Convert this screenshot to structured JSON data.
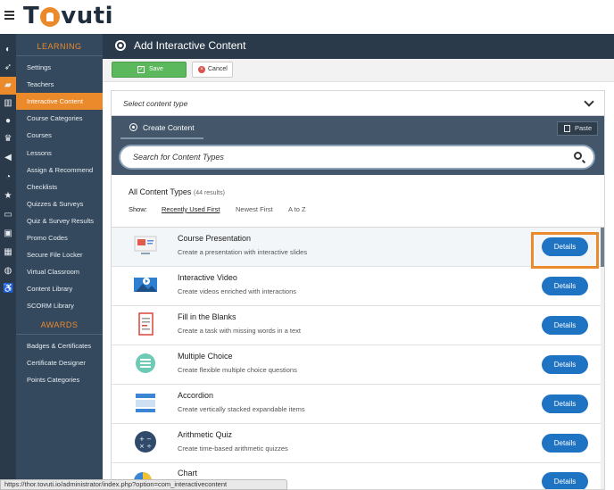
{
  "app": {
    "logo_text": "Tovuti"
  },
  "sidebar": {
    "sections": [
      {
        "heading": "LEARNING",
        "items": [
          {
            "label": "Settings"
          },
          {
            "label": "Teachers"
          },
          {
            "label": "Interactive Content",
            "active": true
          },
          {
            "label": "Course Categories"
          },
          {
            "label": "Courses"
          },
          {
            "label": "Lessons"
          },
          {
            "label": "Assign & Recommend"
          },
          {
            "label": "Checklists"
          },
          {
            "label": "Quizzes & Surveys"
          },
          {
            "label": "Quiz & Survey Results"
          },
          {
            "label": "Promo Codes"
          },
          {
            "label": "Secure File Locker"
          },
          {
            "label": "Virtual Classroom"
          },
          {
            "label": "Content Library"
          },
          {
            "label": "SCORM Library"
          }
        ]
      },
      {
        "heading": "AWARDS",
        "items": [
          {
            "label": "Badges & Certificates"
          },
          {
            "label": "Certificate Designer"
          },
          {
            "label": "Points Categories"
          }
        ]
      }
    ],
    "rail_icons": [
      "dashboard-icon",
      "rocket-icon",
      "graduation-cap-icon",
      "bar-chart-icon",
      "users-icon",
      "trophy-icon",
      "megaphone-icon",
      "rss-icon",
      "star-icon",
      "credit-card-icon",
      "contact-card-icon",
      "calendar-icon",
      "chat-icon",
      "accessibility-icon"
    ]
  },
  "header": {
    "title": "Add Interactive Content"
  },
  "toolbar": {
    "save_label": "Save",
    "cancel_label": "Cancel"
  },
  "h5p": {
    "select_label": "Select content type",
    "create_tab": "Create Content",
    "paste_label": "Paste",
    "search_placeholder": "Search for Content Types",
    "list_title": "All Content Types",
    "list_count": "(44 results)",
    "show_label": "Show:",
    "sort_options": [
      {
        "label": "Recently Used First",
        "active": true
      },
      {
        "label": "Newest First"
      },
      {
        "label": "A to Z"
      }
    ],
    "details_label": "Details",
    "content_types": [
      {
        "name": "Course Presentation",
        "desc": "Create a presentation with interactive slides",
        "icon": "presentation-icon",
        "highlighted": true
      },
      {
        "name": "Interactive Video",
        "desc": "Create videos enriched with interactions",
        "icon": "video-icon"
      },
      {
        "name": "Fill in the Blanks",
        "desc": "Create a task with missing words in a text",
        "icon": "document-icon"
      },
      {
        "name": "Multiple Choice",
        "desc": "Create flexible multiple choice questions",
        "icon": "multiple-choice-icon"
      },
      {
        "name": "Accordion",
        "desc": "Create vertically stacked expandable items",
        "icon": "accordion-icon"
      },
      {
        "name": "Arithmetic Quiz",
        "desc": "Create time-based arithmetic quizzes",
        "icon": "arithmetic-icon"
      },
      {
        "name": "Chart",
        "desc": "",
        "icon": "pie-chart-icon"
      }
    ]
  },
  "status_url": "https://thor.tovuti.io/administrator/index.php?option=com_interactivecontent",
  "colors": {
    "accent": "#ea8a2a",
    "sidebar": "#34495e",
    "primary_button": "#1f73c3",
    "save_green": "#5cb85c"
  }
}
